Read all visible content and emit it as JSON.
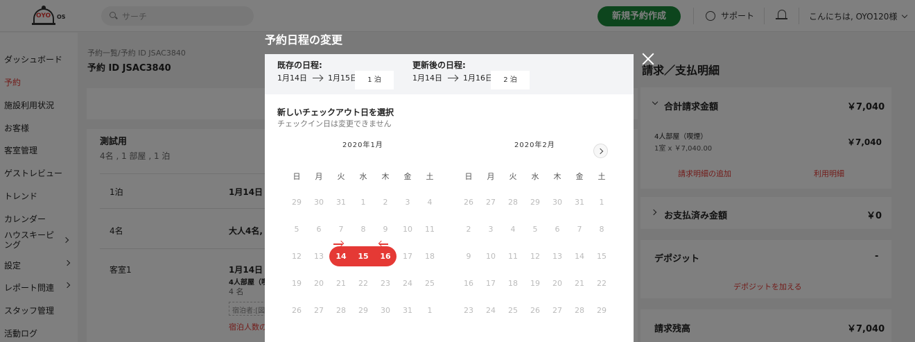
{
  "header": {
    "logo_text": "OYO",
    "logo_suffix": "OS",
    "search_placeholder": "サーチ",
    "new_reservation": "新規予約作成",
    "support": "サポート",
    "greeting": "こんにちは, OYO120様"
  },
  "sidebar": {
    "items": [
      {
        "label": "ダッシュボード"
      },
      {
        "label": "予約"
      },
      {
        "label": "施設利用状況"
      },
      {
        "label": "お客様"
      },
      {
        "label": "客室管理"
      },
      {
        "label": "ゲストレビュー"
      },
      {
        "label": "トレンド"
      },
      {
        "label": "カレンダー"
      },
      {
        "label": "ハウスキーピング"
      },
      {
        "label": "設定"
      },
      {
        "label": "レポート問連"
      },
      {
        "label": "スタッフ管理"
      },
      {
        "label": "活動ログ"
      }
    ]
  },
  "reservation": {
    "breadcrumb": "予約一覧/予約 ID JSAC3840",
    "id_title": "予約 ID JSAC3840",
    "guest_name": "測試用",
    "summary": "4名 , 1 部屋 , 1 泊",
    "rows": [
      {
        "label": "1泊",
        "value": "1月14日 -"
      },
      {
        "label": "4名",
        "value": "大人4名,"
      },
      {
        "label": "客室1",
        "value": "1月14日 -",
        "room": "4人部屋（喫",
        "count": "4 名"
      }
    ],
    "guest_field": "宿泊者:[図",
    "warning": "宿泊人数の"
  },
  "billing": {
    "title": "請求／支払明細",
    "total_label": "合計請求金額",
    "total_value": "￥7,040",
    "room_name": "4人部屋（喫煙）",
    "room_detail": "1室 x ￥7,040.00",
    "room_value": "￥7,040",
    "add_detail": "請求明細の追加",
    "usage_detail": "利用明細",
    "paid_label": "お支払済み金額",
    "paid_value": "￥0",
    "deposit_label": "デポジット",
    "deposit_value": "-",
    "add_deposit": "デポジットを加える",
    "balance_label": "請求残高",
    "balance_value": "￥7,040"
  },
  "modal": {
    "title": "予約日程の変更",
    "existing_label": "既存の日程:",
    "existing_from": "1月14日",
    "existing_to": "1月15日",
    "existing_nights": "1 泊",
    "updated_label": "更新後の日程:",
    "updated_from": "1月14日",
    "updated_to": "1月16日",
    "updated_nights": "2 泊",
    "select_title": "新しいチェックアウト日を選択",
    "select_sub": "チェックイン日は変更できません",
    "weekdays": [
      "日",
      "月",
      "火",
      "水",
      "木",
      "金",
      "土"
    ],
    "months": [
      {
        "title": "2020年1月",
        "weeks": [
          [
            "29",
            "30",
            "31",
            "1",
            "2",
            "3",
            "4"
          ],
          [
            "5",
            "6",
            "7",
            "8",
            "9",
            "10",
            "11"
          ],
          [
            "12",
            "13",
            "14",
            "15",
            "16",
            "17",
            "18"
          ],
          [
            "19",
            "20",
            "21",
            "22",
            "23",
            "24",
            "25"
          ],
          [
            "26",
            "27",
            "28",
            "29",
            "30",
            "31",
            "1"
          ]
        ]
      },
      {
        "title": "2020年2月",
        "weeks": [
          [
            "26",
            "27",
            "28",
            "29",
            "30",
            "31",
            "1"
          ],
          [
            "2",
            "3",
            "4",
            "5",
            "6",
            "7",
            "8"
          ],
          [
            "9",
            "10",
            "11",
            "12",
            "13",
            "14",
            "15"
          ],
          [
            "16",
            "17",
            "18",
            "19",
            "20",
            "21",
            "22"
          ],
          [
            "23",
            "24",
            "25",
            "26",
            "27",
            "28",
            "29"
          ]
        ]
      }
    ],
    "selected_range": {
      "month": 0,
      "week": 2,
      "days": [
        2,
        3,
        4
      ]
    }
  },
  "colors": {
    "brand_red": "#e53935",
    "brand_green": "#1b8a3a"
  }
}
